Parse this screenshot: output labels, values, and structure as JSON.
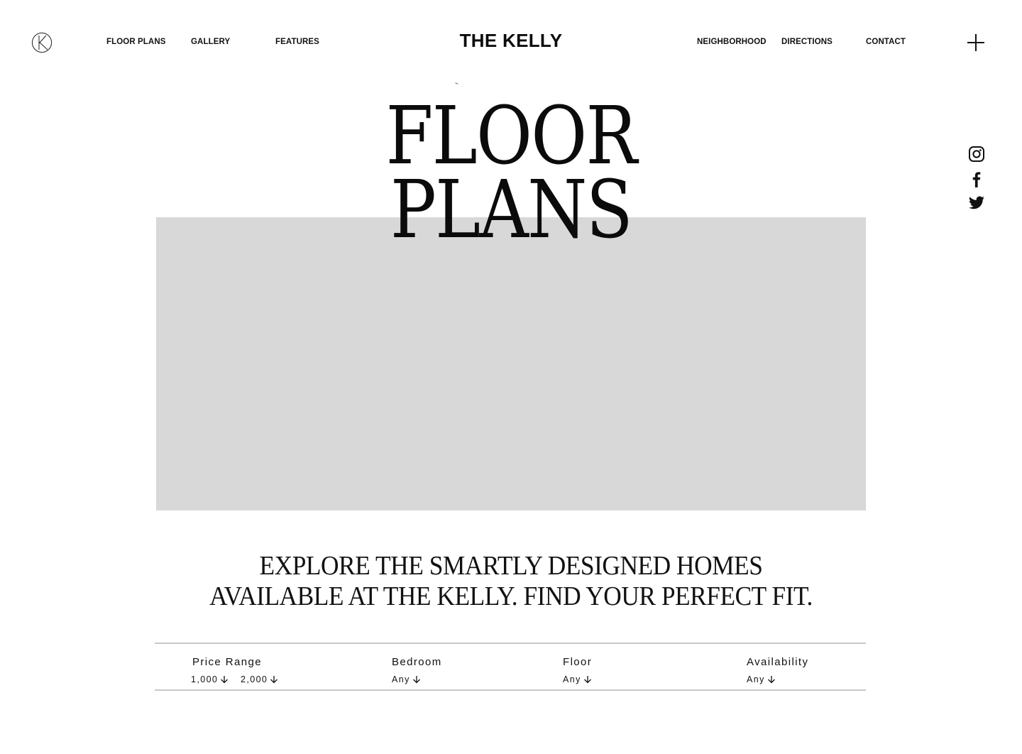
{
  "header": {
    "brand": "THE KELLY",
    "nav_left": [
      "FLOOR PLANS",
      "GALLERY",
      "FEATURES"
    ],
    "nav_right": [
      "NEIGHBORHOOD",
      "DIRECTIONS",
      "CONTACT"
    ]
  },
  "social": [
    "instagram-icon",
    "facebook-icon",
    "twitter-icon"
  ],
  "hero": {
    "title_line1": "FLOOR",
    "title_line2": "PLANS",
    "image_color": "#d8d8d8"
  },
  "intro": {
    "line1": "EXPLORE THE SMARTLY DESIGNED HOMES",
    "line2": "AVAILABLE AT THE KELLY. FIND YOUR PERFECT FIT."
  },
  "filters": {
    "price": {
      "label": "Price Range",
      "min": "1,000",
      "max": "2,000"
    },
    "bedroom": {
      "label": "Bedroom",
      "value": "Any"
    },
    "floor": {
      "label": "Floor",
      "value": "Any"
    },
    "availability": {
      "label": "Availability",
      "value": "Any"
    }
  }
}
